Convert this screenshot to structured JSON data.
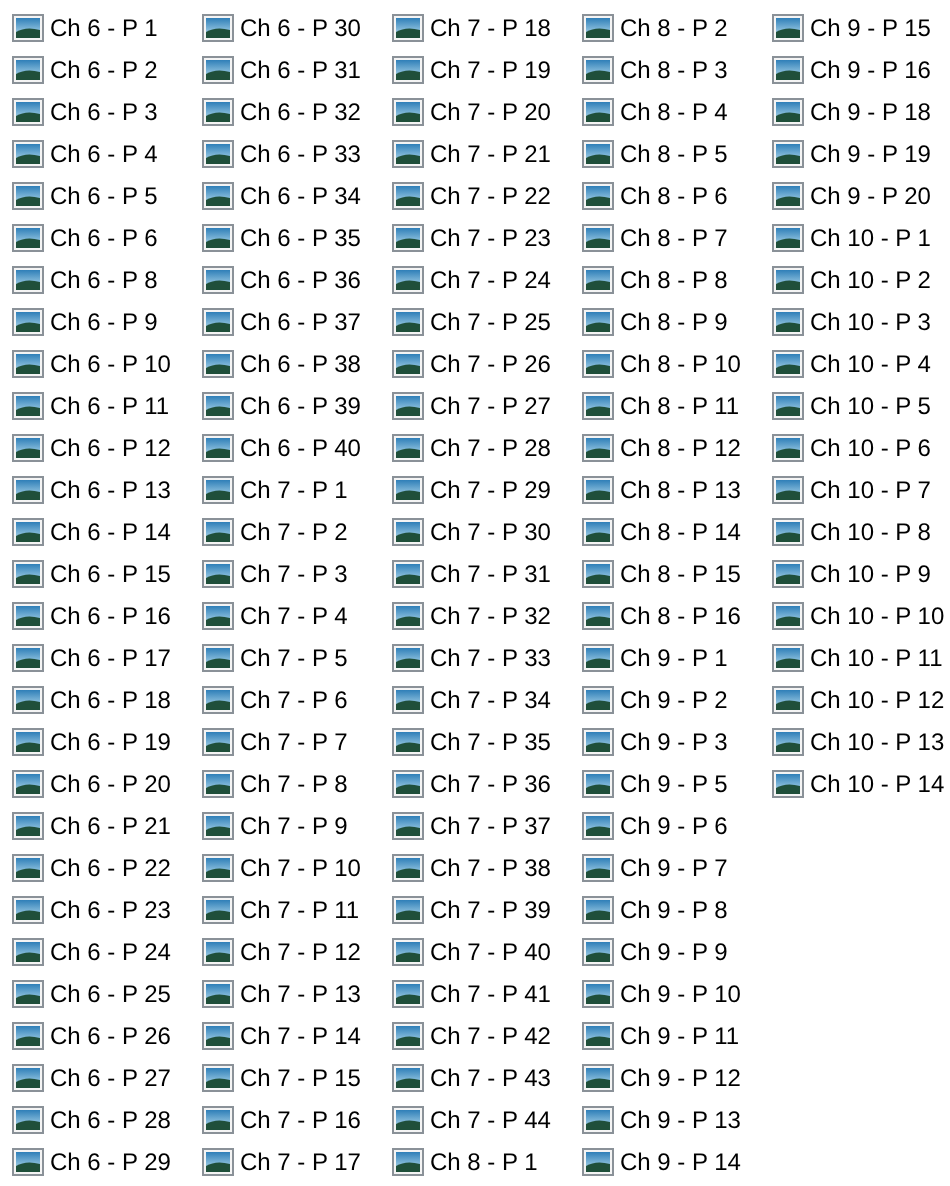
{
  "files": [
    "Ch 6 - P 1",
    "Ch 6 - P 2",
    "Ch 6 - P 3",
    "Ch 6 - P 4",
    "Ch 6 - P 5",
    "Ch 6 - P 6",
    "Ch 6 - P 8",
    "Ch 6 - P 9",
    "Ch 6 - P 10",
    "Ch 6 - P 11",
    "Ch 6 - P 12",
    "Ch 6 - P 13",
    "Ch 6 - P 14",
    "Ch 6 - P 15",
    "Ch 6 - P 16",
    "Ch 6 - P 17",
    "Ch 6 - P 18",
    "Ch 6 - P 19",
    "Ch 6 - P 20",
    "Ch 6 - P 21",
    "Ch 6 - P 22",
    "Ch 6 - P 23",
    "Ch 6 - P 24",
    "Ch 6 - P 25",
    "Ch 6 - P 26",
    "Ch 6 - P 27",
    "Ch 6 - P 28",
    "Ch 6 - P 29",
    "Ch 6 - P 30",
    "Ch 6 - P 31",
    "Ch 6 - P 32",
    "Ch 6 - P 33",
    "Ch 6 - P 34",
    "Ch 6 - P 35",
    "Ch 6 - P 36",
    "Ch 6 - P 37",
    "Ch 6 - P 38",
    "Ch 6 - P 39",
    "Ch 6 - P 40",
    "Ch 7 - P 1",
    "Ch 7 - P 2",
    "Ch 7 - P 3",
    "Ch 7 - P 4",
    "Ch 7 - P 5",
    "Ch 7 - P 6",
    "Ch 7 - P 7",
    "Ch 7 - P 8",
    "Ch 7 - P 9",
    "Ch 7 - P 10",
    "Ch 7 - P 11",
    "Ch 7 - P 12",
    "Ch 7 - P 13",
    "Ch 7 - P 14",
    "Ch 7 - P 15",
    "Ch 7 - P 16",
    "Ch 7 - P 17",
    "Ch 7 - P 18",
    "Ch 7 - P 19",
    "Ch 7 - P 20",
    "Ch 7 - P 21",
    "Ch 7 - P 22",
    "Ch 7 - P 23",
    "Ch 7 - P 24",
    "Ch 7 - P 25",
    "Ch 7 - P 26",
    "Ch 7 - P 27",
    "Ch 7 - P 28",
    "Ch 7 - P 29",
    "Ch 7 - P 30",
    "Ch 7 - P 31",
    "Ch 7 - P 32",
    "Ch 7 - P 33",
    "Ch 7 - P 34",
    "Ch 7 - P 35",
    "Ch 7 - P 36",
    "Ch 7 - P 37",
    "Ch 7 - P 38",
    "Ch 7 - P 39",
    "Ch 7 - P 40",
    "Ch 7 - P 41",
    "Ch 7 - P 42",
    "Ch 7 - P 43",
    "Ch 7 - P 44",
    "Ch 8 - P 1",
    "Ch 8 - P 2",
    "Ch 8 - P 3",
    "Ch 8 - P 4",
    "Ch 8 - P 5",
    "Ch 8 - P 6",
    "Ch 8 - P 7",
    "Ch 8 - P 8",
    "Ch 8 - P 9",
    "Ch 8 - P 10",
    "Ch 8 - P 11",
    "Ch 8 - P 12",
    "Ch 8 - P 13",
    "Ch 8 - P 14",
    "Ch 8 - P 15",
    "Ch 8 - P 16",
    "Ch 9 - P 1",
    "Ch 9 - P 2",
    "Ch 9 - P 3",
    "Ch 9 - P 5",
    "Ch 9 - P 6",
    "Ch 9 - P 7",
    "Ch 9 - P 8",
    "Ch 9 - P 9",
    "Ch 9 - P 10",
    "Ch 9 - P 11",
    "Ch 9 - P 12",
    "Ch 9 - P 13",
    "Ch 9 - P 14",
    "Ch 9 - P 15",
    "Ch 9 - P 16",
    "Ch 9 - P 18",
    "Ch 9 - P 19",
    "Ch 9 - P 20",
    "Ch 10 - P 1",
    "Ch 10 - P 2",
    "Ch 10 - P 3",
    "Ch 10 - P 4",
    "Ch 10 - P 5",
    "Ch 10 - P 6",
    "Ch 10 - P 7",
    "Ch 10 - P 8",
    "Ch 10 - P 9",
    "Ch 10 - P 10",
    "Ch 10 - P 11",
    "Ch 10 - P 12",
    "Ch 10 - P 13",
    "Ch 10 - P 14"
  ]
}
